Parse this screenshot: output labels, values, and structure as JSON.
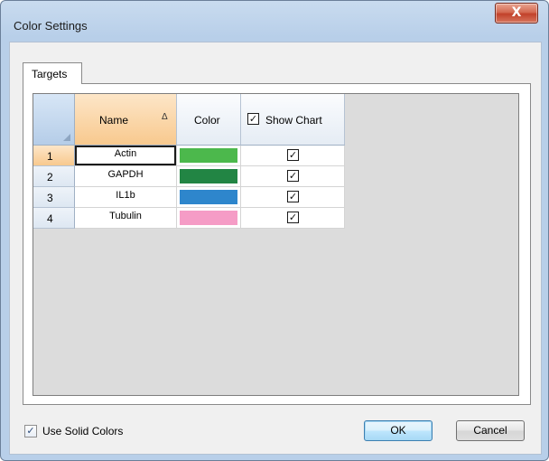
{
  "window": {
    "title": "Color Settings",
    "close_glyph": "X"
  },
  "tabs": [
    {
      "label": "Targets"
    }
  ],
  "grid": {
    "columns": [
      {
        "label": "Name",
        "sort": "ascending",
        "sort_glyph": "Δ"
      },
      {
        "label": "Color"
      },
      {
        "label": "Show Chart",
        "checked": true
      }
    ],
    "check_glyph": "✓",
    "rows": [
      {
        "index": "1",
        "name": "Actin",
        "color": "#4cb84c",
        "show_chart": true
      },
      {
        "index": "2",
        "name": "GAPDH",
        "color": "#228544",
        "show_chart": true
      },
      {
        "index": "3",
        "name": "IL1b",
        "color": "#2e86cc",
        "show_chart": true
      },
      {
        "index": "4",
        "name": "Tubulin",
        "color": "#f59cc6",
        "show_chart": true
      }
    ]
  },
  "footer": {
    "use_solid_colors": {
      "label": "Use Solid Colors",
      "checked": true
    },
    "ok_label": "OK",
    "cancel_label": "Cancel"
  }
}
